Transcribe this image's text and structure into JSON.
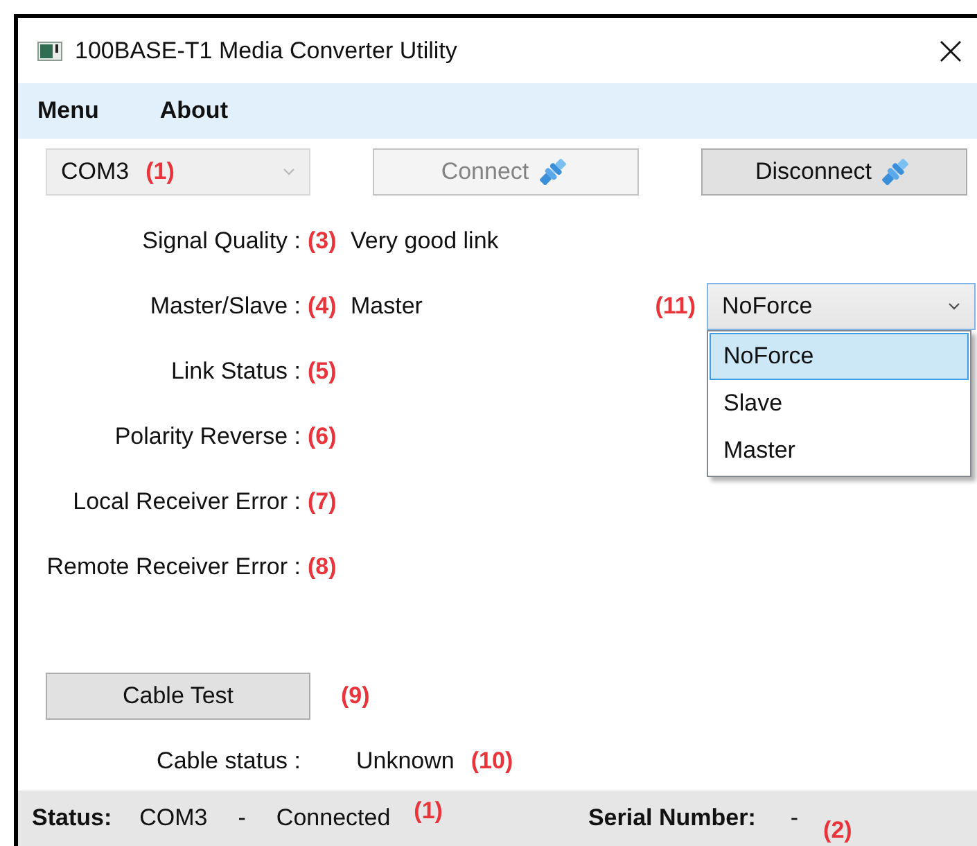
{
  "window": {
    "title": "100BASE-T1 Media Converter Utility"
  },
  "menu": [
    {
      "label": "Menu"
    },
    {
      "label": "About"
    }
  ],
  "toolbar": {
    "port": {
      "value": "COM3",
      "disabled": true,
      "annotation": "(1)"
    },
    "buttons": [
      {
        "label": "Connect",
        "disabled": true
      },
      {
        "label": "Disconnect",
        "disabled": false
      }
    ]
  },
  "fields": [
    {
      "label": "Signal Quality :",
      "annotation": "(3)",
      "value": "Very good link"
    },
    {
      "label": "Master/Slave :",
      "annotation": "(4)",
      "value": "Master"
    },
    {
      "label": "Link Status :",
      "annotation": "(5)"
    },
    {
      "label": "Polarity Reverse :",
      "annotation": "(6)"
    },
    {
      "label": "Local Receiver Error :",
      "annotation": "(7)"
    },
    {
      "label": "Remote Receiver Error :",
      "annotation": "(8)"
    }
  ],
  "force_mode": {
    "annotation": "(11)",
    "value": "NoForce",
    "expanded": true,
    "options": [
      {
        "label": "NoForce",
        "selected": true
      },
      {
        "label": "Slave",
        "selected": false
      },
      {
        "label": "Master",
        "selected": false
      }
    ]
  },
  "cable_test": {
    "button": "Cable Test",
    "annotation": "(9)",
    "status_label": "Cable status :",
    "status_value": "Unknown",
    "status_annotation": "(10)"
  },
  "status_bar": {
    "status_label": "Status:",
    "port": "COM3",
    "separator": "-",
    "state": "Connected",
    "status_annotation": "(1)",
    "serial_label": "Serial Number:",
    "serial_value": "-",
    "serial_annotation": "(2)"
  }
}
